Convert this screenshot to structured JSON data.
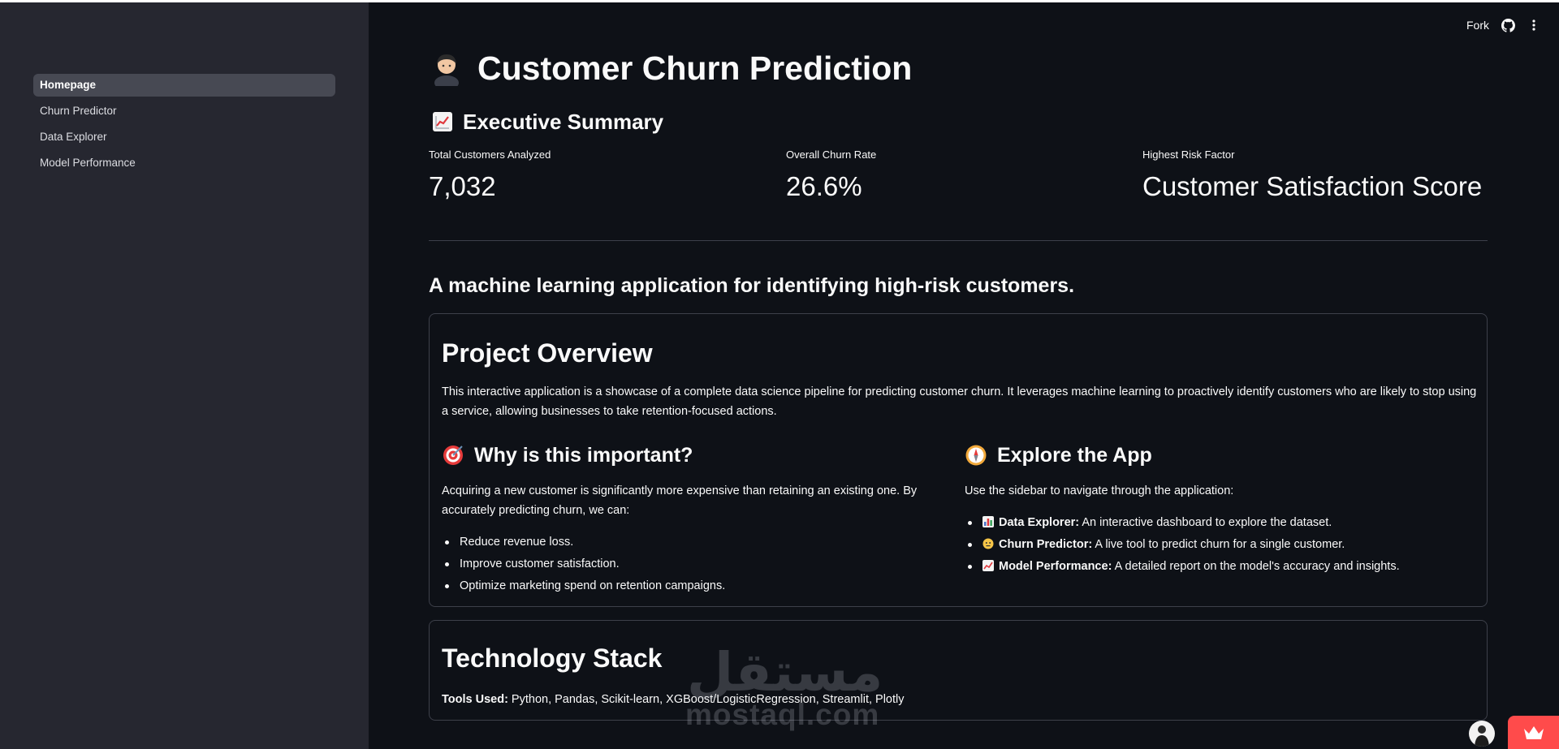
{
  "sidebar": {
    "items": [
      {
        "label": "Homepage",
        "active": true
      },
      {
        "label": "Churn Predictor",
        "active": false
      },
      {
        "label": "Data Explorer",
        "active": false
      },
      {
        "label": "Model Performance",
        "active": false
      }
    ]
  },
  "topbar": {
    "fork_label": "Fork",
    "icons": [
      "github-icon",
      "more-vertical-icon"
    ]
  },
  "header": {
    "title": "Customer Churn Prediction",
    "title_icon": "person-icon"
  },
  "summary": {
    "heading": "Executive Summary",
    "heading_icon": "chart-increasing-icon",
    "metrics": [
      {
        "label": "Total Customers Analyzed",
        "value": "7,032"
      },
      {
        "label": "Overall Churn Rate",
        "value": "26.6%"
      },
      {
        "label": "Highest Risk Factor",
        "value": "Customer Satisfaction Score"
      }
    ]
  },
  "tagline": "A machine learning application for identifying high-risk customers.",
  "overview": {
    "heading": "Project Overview",
    "paragraph": "This interactive application is a showcase of a complete data science pipeline for predicting customer churn. It leverages machine learning to proactively identify customers who are likely to stop using a service, allowing businesses to take retention-focused actions.",
    "why": {
      "heading": "Why is this important?",
      "icon": "target-icon",
      "text": "Acquiring a new customer is significantly more expensive than retaining an existing one. By accurately predicting churn, we can:",
      "bullets": [
        "Reduce revenue loss.",
        "Improve customer satisfaction.",
        "Optimize marketing spend on retention campaigns."
      ]
    },
    "explore": {
      "heading": "Explore the App",
      "icon": "compass-icon",
      "text": "Use the sidebar to navigate through the application:",
      "items": [
        {
          "icon": "bar-chart-icon",
          "strong": "Data Explorer:",
          "text": " An interactive dashboard to explore the dataset."
        },
        {
          "icon": "face-icon",
          "strong": "Churn Predictor:",
          "text": " A live tool to predict churn for a single customer."
        },
        {
          "icon": "chart-increasing-icon",
          "strong": "Model Performance:",
          "text": " A detailed report on the model's accuracy and insights."
        }
      ]
    }
  },
  "tech": {
    "heading": "Technology Stack",
    "tools_label": "Tools Used:",
    "tools": " Python, Pandas, Scikit-learn, XGBoost/LogisticRegression, Streamlit, Plotly"
  },
  "watermark": {
    "arabic": "مستقل",
    "latin": "mostaql.com"
  },
  "colors": {
    "background": "#0e1117",
    "sidebar": "#262730",
    "accent": "#ff4b4b"
  }
}
